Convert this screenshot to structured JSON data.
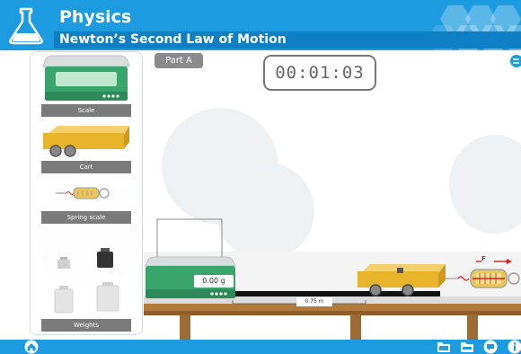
{
  "header": {
    "app_title": "Physics",
    "lesson_title": "Newton’s Second Law of Motion"
  },
  "toolbar": {
    "part_tab": "Part A",
    "timer": "00:01:03"
  },
  "equipment": [
    {
      "label": "Scale"
    },
    {
      "label": "Cart"
    },
    {
      "label": "Spring scale"
    },
    {
      "label": "Weights"
    }
  ],
  "scene": {
    "scale_readout": "0.00 g",
    "track_distance": "0.75 m",
    "force_label": "F"
  },
  "colors": {
    "header_blue": "#1d9be0",
    "dark_blue": "#0e7fc4",
    "scale_green": "#3aa56b",
    "cart_yellow": "#e8b52a",
    "spring_red": "#d32020"
  },
  "icons": {
    "home": "home-icon",
    "reset": "reset-icon",
    "footer": [
      "folder-open-icon",
      "folder-icon",
      "chat-icon",
      "info-icon"
    ]
  }
}
